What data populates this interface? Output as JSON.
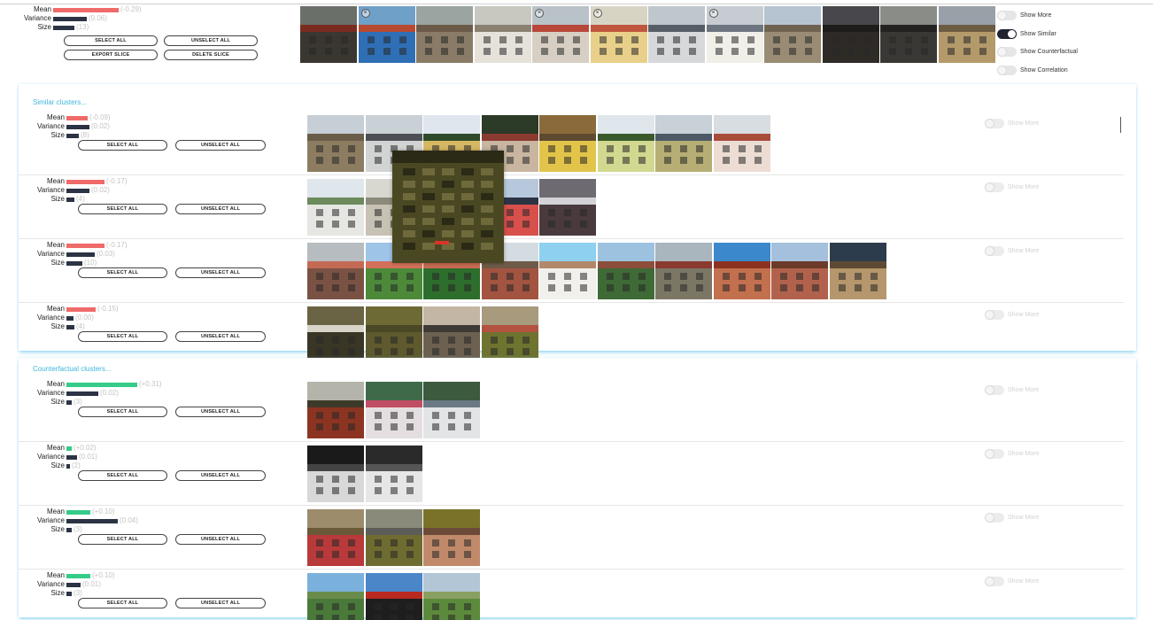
{
  "top_slice": {
    "stats": {
      "mean_label": "Mean",
      "mean_value": "(-0.29)",
      "variance_label": "Variance",
      "variance_value": "(0.06)",
      "size_label": "Size",
      "size_value": "(13)"
    },
    "buttons": {
      "select_all": "SELECT ALL",
      "unselect_all": "UNSELECT ALL",
      "export_slice": "EXPORT SLICE",
      "delete_slice": "DELETE SLICE"
    },
    "toggles": [
      {
        "label": "Show More",
        "on": false
      },
      {
        "label": "Show Similar",
        "on": true
      },
      {
        "label": "Show Counterfactual",
        "on": false
      },
      {
        "label": "Show Correlation",
        "on": false
      }
    ],
    "images": [
      {
        "sky": "#6b6f6a",
        "wall": "#3a3630",
        "roof": "#7a2b20"
      },
      {
        "sky": "#6fa0c8",
        "wall": "#2f6fb6",
        "roof": "#b84a30",
        "x": true
      },
      {
        "sky": "#9aa4a0",
        "wall": "#8a7b66",
        "roof": "#6c5a48"
      },
      {
        "sky": "#c8c8c0",
        "wall": "#e6e2da",
        "roof": "#8a8070"
      },
      {
        "sky": "#b8c2c8",
        "wall": "#d8cfc4",
        "roof": "#b8473a",
        "x": true
      },
      {
        "sky": "#d8d4c4",
        "wall": "#e8d08a",
        "roof": "#c0563e",
        "x": true
      },
      {
        "sky": "#bfc6cc",
        "wall": "#d6d8da",
        "roof": "#555d66"
      },
      {
        "sky": "#c6ccd2",
        "wall": "#f0efe8",
        "roof": "#6d7580",
        "x": true
      },
      {
        "sky": "#b6c4d2",
        "wall": "#9a8c74",
        "roof": "#6f6250"
      },
      {
        "sky": "#48484c",
        "wall": "#2e2a26",
        "roof": "#1e1c1a"
      },
      {
        "sky": "#8a8c88",
        "wall": "#3a3834",
        "roof": "#242220"
      },
      {
        "sky": "#9aa0a8",
        "wall": "#b49a6a",
        "roof": "#6c5c44"
      }
    ]
  },
  "similar": {
    "title": "Similar clusters...",
    "clusters": [
      {
        "mean": "(-0.09)",
        "variance": "(0.02)",
        "size": "(8)",
        "mean_w": 24,
        "var_w": 26,
        "size_w": 14,
        "images": [
          {
            "sky": "#c6cfd6",
            "wall": "#8c7c60",
            "roof": "#6a5d48"
          },
          {
            "sky": "#c9d0d6",
            "wall": "#d2d4d4",
            "roof": "#4c5054"
          },
          {
            "sky": "#dfe6ee",
            "wall": "#d6b864",
            "roof": "#2f4a2a"
          },
          {
            "sky": "#2c3a28",
            "wall": "#c8b6a0",
            "roof": "#8b3a30"
          },
          {
            "sky": "#8a6a3a",
            "wall": "#e2c44a",
            "roof": "#5e4a30"
          },
          {
            "sky": "#dfe7ec",
            "wall": "#d2d890",
            "roof": "#3a5a2c"
          },
          {
            "sky": "#c8d0d8",
            "wall": "#b6ae74",
            "roof": "#4c5a66"
          },
          {
            "sky": "#d8dde2",
            "wall": "#ecdcd2",
            "roof": "#a84c3a"
          }
        ],
        "toggle": "Show More"
      },
      {
        "mean": "(-0.17)",
        "variance": "(0.02)",
        "size": "(4)",
        "mean_w": 43,
        "var_w": 26,
        "size_w": 9,
        "images": [
          {
            "sky": "#dfe6ec",
            "wall": "#e6e6e2",
            "roof": "#6c8a5c"
          },
          {
            "sky": "#d8d8d0",
            "wall": "#c8c2b4",
            "roof": "#8c8a7a"
          },
          {
            "sky": "#b8c6d4",
            "wall": "#d2d6da",
            "roof": "#8a9aa6"
          },
          {
            "sky": "#b8c8dc",
            "wall": "#d8504c",
            "roof": "#2c3444"
          },
          {
            "sky": "#6e6a72",
            "wall": "#4a3a3e",
            "roof": "#d4d2d6"
          }
        ],
        "toggle": "Show More"
      },
      {
        "mean": "(-0.17)",
        "variance": "(0.03)",
        "size": "(10)",
        "mean_w": 43,
        "var_w": 32,
        "size_w": 18,
        "images": [
          {
            "sky": "#b6bcc0",
            "wall": "#7a5244",
            "roof": "#c46a54"
          },
          {
            "sky": "#9ec4e8",
            "wall": "#4c8a3a",
            "roof": "#d2705a"
          },
          {
            "sky": "#7ab8e4",
            "wall": "#2e6e2c",
            "roof": "#c86a52"
          },
          {
            "sky": "#d4dce2",
            "wall": "#a25440",
            "roof": "#6e5a48"
          },
          {
            "sky": "#8ed0f0",
            "wall": "#f2f0ec",
            "roof": "#b2886a"
          },
          {
            "sky": "#9cc2e0",
            "wall": "#3e6a36",
            "roof": "#8c4e3a"
          },
          {
            "sky": "#aab6be",
            "wall": "#7c7664",
            "roof": "#8a3a2e"
          },
          {
            "sky": "#3c88cc",
            "wall": "#c2704e",
            "roof": "#8c3222"
          },
          {
            "sky": "#a4c0dc",
            "wall": "#b2624c",
            "roof": "#6c3a2a"
          },
          {
            "sky": "#2c3c4c",
            "wall": "#b6966c",
            "roof": "#5e4a34"
          }
        ],
        "toggle": "Show More"
      },
      {
        "mean": "(-0.15)",
        "variance": "(0.00)",
        "size": "(4)",
        "mean_w": 33,
        "var_w": 8,
        "size_w": 9,
        "images": [
          {
            "sky": "#6a6444",
            "wall": "#3a3626",
            "roof": "#d8d4c8"
          },
          {
            "sky": "#6e6a36",
            "wall": "#5e5a2e",
            "roof": "#4a4826"
          },
          {
            "sky": "#c4b6a4",
            "wall": "#6c6050",
            "roof": "#3e3a34"
          },
          {
            "sky": "#a89a7c",
            "wall": "#6e7430",
            "roof": "#b45242"
          }
        ],
        "toggle": "Show More"
      }
    ],
    "buttons": {
      "select_all": "SELECT ALL",
      "unselect_all": "UNSELECT ALL"
    }
  },
  "counterfactual": {
    "title": "Counterfactual clusters...",
    "clusters": [
      {
        "mean": "(+0.31)",
        "variance": "(0.02)",
        "size": "(3)",
        "mean_w": 80,
        "var_w": 36,
        "size_w": 6,
        "images": [
          {
            "sky": "#b4b4aa",
            "wall": "#8c3422",
            "roof": "#3e3a2a"
          },
          {
            "sky": "#3e6a4a",
            "wall": "#e4dee0",
            "roof": "#c04e64"
          },
          {
            "sky": "#3c5a3e",
            "wall": "#e2e4e6",
            "roof": "#6a7a84"
          }
        ],
        "toggle": "Show More"
      },
      {
        "mean": "(+0.02)",
        "variance": "(0.01)",
        "size": "(2)",
        "mean_w": 6,
        "var_w": 12,
        "size_w": 4,
        "images": [
          {
            "sky": "#1a1a1a",
            "wall": "#d8d8d8",
            "roof": "#444444"
          },
          {
            "sky": "#2a2a2a",
            "wall": "#e6e6e6",
            "roof": "#555555"
          }
        ],
        "toggle": "Show More"
      },
      {
        "mean": "(+0.10)",
        "variance": "(0.04)",
        "size": "(3)",
        "mean_w": 27,
        "var_w": 58,
        "size_w": 6,
        "images": [
          {
            "sky": "#9c8c6c",
            "wall": "#b83a3a",
            "roof": "#6a5a3a"
          },
          {
            "sky": "#8a8a7a",
            "wall": "#6e6c30",
            "roof": "#5c5c58"
          },
          {
            "sky": "#7a7228",
            "wall": "#c08a6a",
            "roof": "#6c4a38"
          }
        ],
        "toggle": "Show More"
      },
      {
        "mean": "(+0.10)",
        "variance": "(0.01)",
        "size": "(3)",
        "mean_w": 27,
        "var_w": 16,
        "size_w": 6,
        "images": [
          {
            "sky": "#7ab0dc",
            "wall": "#4a7a3a",
            "roof": "#6a8c4a"
          },
          {
            "sky": "#4a86c8",
            "wall": "#1e1e1e",
            "roof": "#b82a20"
          },
          {
            "sky": "#b2c6d6",
            "wall": "#5c8a3c",
            "roof": "#8aa062"
          }
        ],
        "toggle": "Show More"
      }
    ],
    "buttons": {
      "select_all": "SELECT ALL",
      "unselect_all": "UNSELECT ALL"
    }
  },
  "preview": {
    "sky": "#6a6238",
    "wall": "#4a4822",
    "roof": "#2a2a16"
  }
}
